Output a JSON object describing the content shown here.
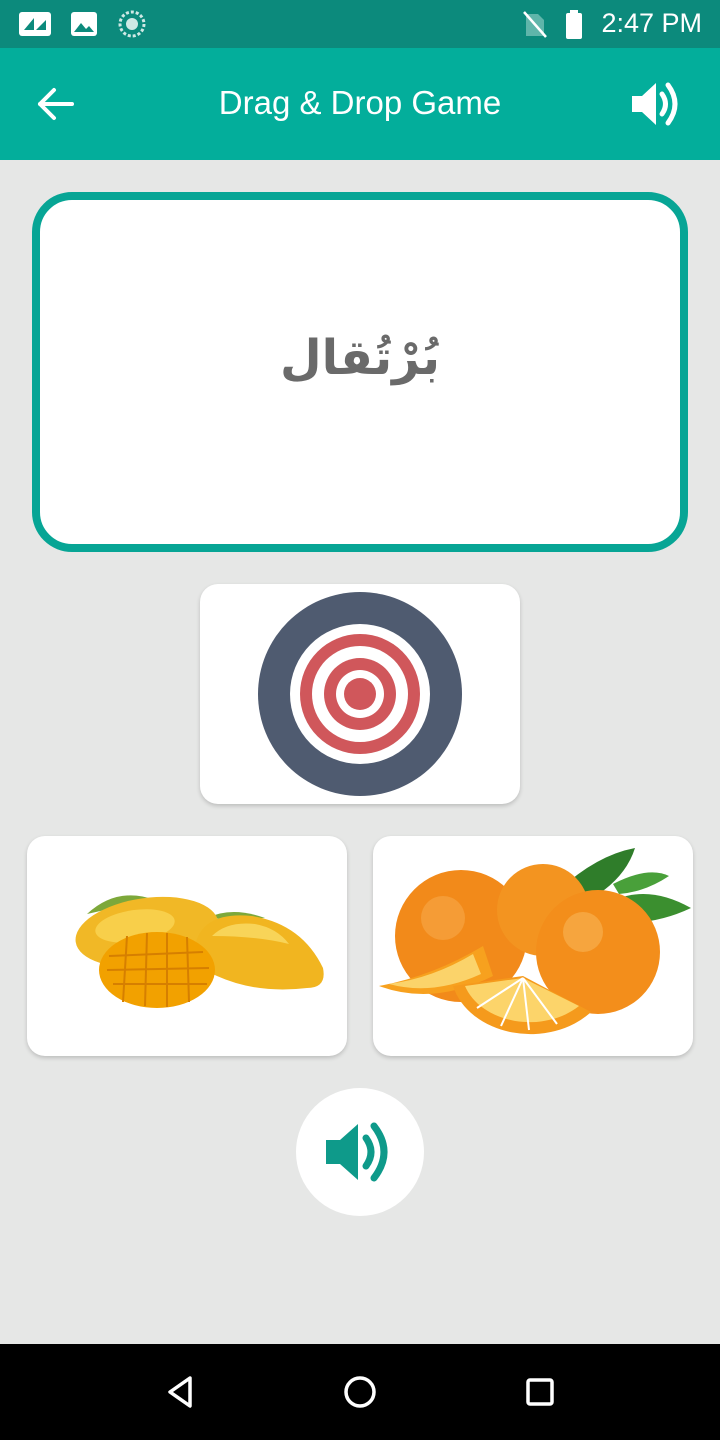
{
  "status_bar": {
    "time": "2:47 PM",
    "icons": [
      "notification-app-icon",
      "gallery-icon",
      "sync-icon",
      "no-sim-icon",
      "battery-icon"
    ]
  },
  "app_bar": {
    "title": "Drag & Drop Game",
    "back_icon": "arrow-left-icon",
    "sound_icon": "volume-icon"
  },
  "word_card": {
    "word": "بُرْتُقال"
  },
  "drop_target": {
    "icon": "target-icon"
  },
  "options": [
    {
      "name": "mango",
      "image": "mango-image"
    },
    {
      "name": "orange",
      "image": "orange-image"
    }
  ],
  "play_sound": {
    "icon": "volume-icon"
  },
  "nav_bar": {
    "buttons": [
      "back-triangle-icon",
      "home-circle-icon",
      "recents-square-icon"
    ]
  },
  "colors": {
    "primary": "#03ae9b",
    "status_bar": "#0c8a7c",
    "card_border": "#07a595",
    "background": "#e6e7e6",
    "target_outer": "#4f5b70",
    "target_red": "#d0575b",
    "sound_icon": "#0e9a8a"
  }
}
